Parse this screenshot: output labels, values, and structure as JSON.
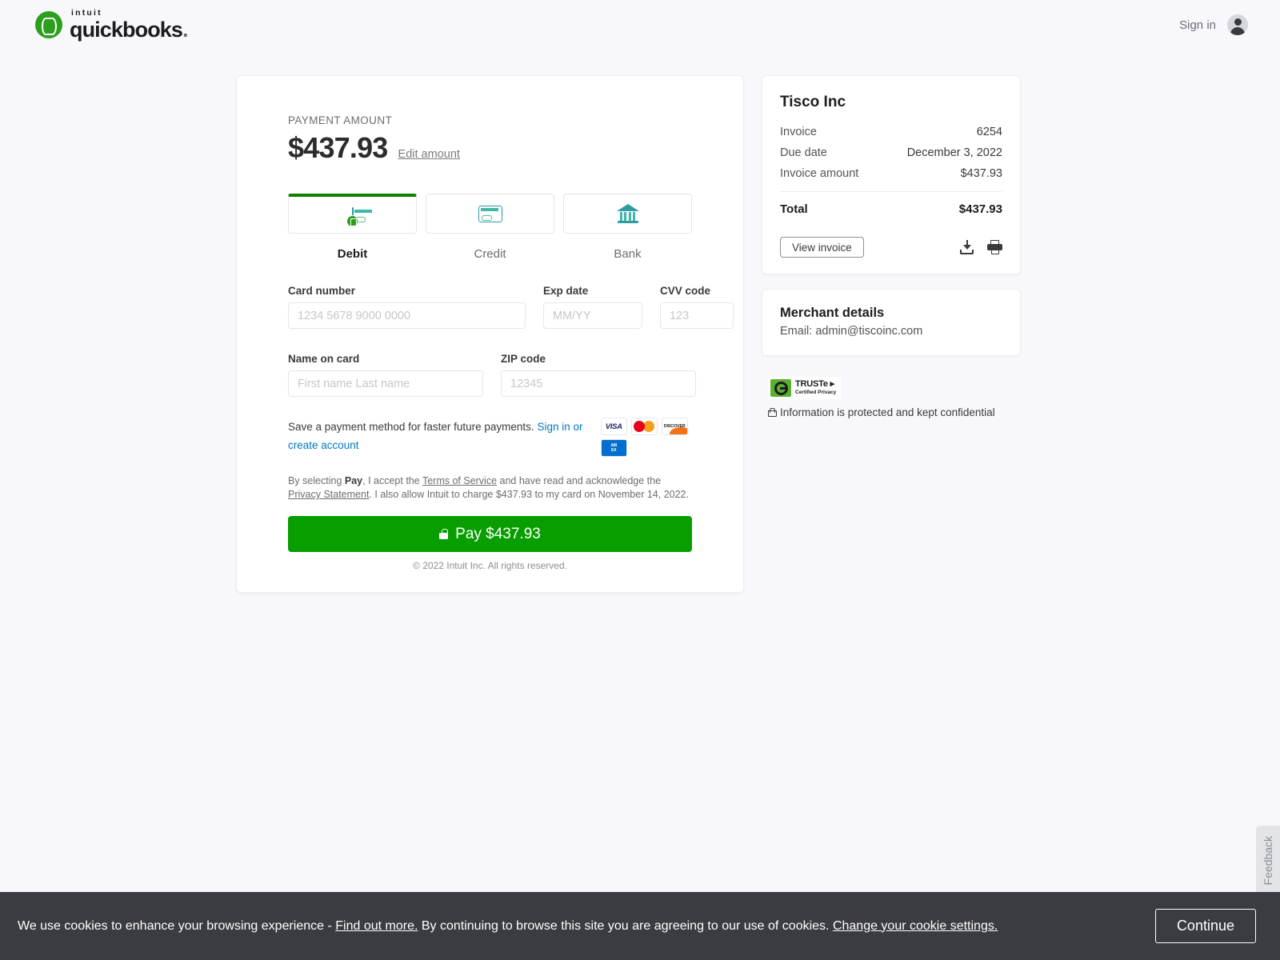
{
  "header": {
    "brand_top": "intuit",
    "brand_main": "quickbooks",
    "signin_label": "Sign in"
  },
  "payment": {
    "amount_label": "PAYMENT AMOUNT",
    "amount_value": "$437.93",
    "edit_amount_label": "Edit amount",
    "tabs": [
      {
        "label": "Debit",
        "icon": "debit-card-icon",
        "active": true
      },
      {
        "label": "Credit",
        "icon": "credit-card-icon",
        "active": false
      },
      {
        "label": "Bank",
        "icon": "bank-building-icon",
        "active": false
      }
    ],
    "fields": {
      "card_number_label": "Card number",
      "card_number_placeholder": "1234 5678 9000 0000",
      "card_number_value": "",
      "exp_date_label": "Exp date",
      "exp_date_placeholder": "MM/YY",
      "exp_date_value": "",
      "cvv_label": "CVV code",
      "cvv_placeholder": "123",
      "cvv_value": "",
      "name_label": "Name on card",
      "name_placeholder": "First name Last name",
      "name_value": "",
      "zip_label": "ZIP code",
      "zip_placeholder": "12345",
      "zip_value": ""
    },
    "save_method": {
      "text": "Save a payment method for faster future payments.",
      "signin_link": "Sign in",
      "create_link": "or create account"
    },
    "card_brands": [
      "VISA",
      "mastercard",
      "DISCOVER",
      "AMEX"
    ],
    "terms": {
      "p1": "By selecting ",
      "bold": "Pay",
      "p2": ", I accept the ",
      "link1": "Terms of Service",
      "p3": " and have read and acknowledge the ",
      "link2": "Privacy Statement",
      "p4": ". I also allow Intuit to charge $437.93 to my card on November 14, 2022."
    },
    "pay_button_label": "Pay $437.93",
    "copyright": "© 2022 Intuit Inc. All rights reserved."
  },
  "invoice": {
    "merchant_name": "Tisco Inc",
    "rows": [
      {
        "label": "Invoice",
        "value": "6254"
      },
      {
        "label": "Due date",
        "value": "December 3, 2022"
      },
      {
        "label": "Invoice amount",
        "value": "$437.93"
      }
    ],
    "total_label": "Total",
    "total_value": "$437.93",
    "view_invoice_label": "View invoice"
  },
  "merchant_details": {
    "title": "Merchant details",
    "email": "Email: admin@tiscoinc.com"
  },
  "trust": {
    "badge_title": "TRUSTe ▸",
    "badge_subtitle": "Certified Privacy",
    "protection_text": "Information is protected and kept confidential"
  },
  "feedback": {
    "label": "Feedback"
  },
  "cookie_banner": {
    "part1": "We use cookies to enhance your browsing experience - ",
    "link1": "Find out more.",
    "part2": "  By continuing to browse this site you are agreeing to our use of cookies.  ",
    "link2": "Change your cookie settings.",
    "continue_label": "Continue"
  },
  "colors": {
    "brand_green": "#2ca01c",
    "pay_green": "#089e00",
    "link_blue": "#0077c5",
    "page_bg": "#f8f8fc",
    "cookie_bg": "#3b3c41"
  }
}
